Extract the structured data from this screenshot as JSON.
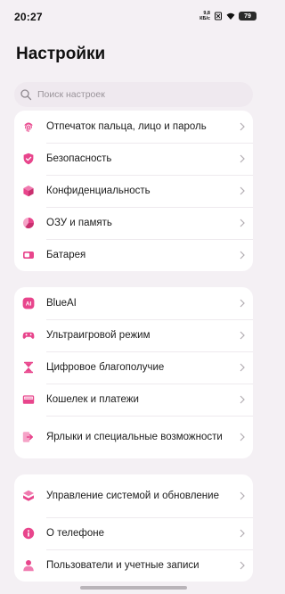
{
  "status": {
    "time": "20:27",
    "speed_value": "9,8",
    "speed_unit": "КБ/с",
    "battery": "79"
  },
  "page": {
    "title": "Настройки"
  },
  "search": {
    "placeholder": "Поиск настроек",
    "value": ""
  },
  "colors": {
    "accent": "#e8458c",
    "background": "#f4f0f4"
  },
  "groups": [
    {
      "items": [
        {
          "label": "Отпечаток пальца, лицо и пароль",
          "icon": "fingerprint-icon"
        },
        {
          "label": "Безопасность",
          "icon": "shield-icon"
        },
        {
          "label": "Конфиденциальность",
          "icon": "privacy-cube-icon"
        },
        {
          "label": "ОЗУ и память",
          "icon": "pie-chart-icon"
        },
        {
          "label": "Батарея",
          "icon": "battery-icon"
        }
      ]
    },
    {
      "items": [
        {
          "label": "BlueAI",
          "icon": "ai-icon"
        },
        {
          "label": "Ультраигровой режим",
          "icon": "gamepad-icon"
        },
        {
          "label": "Цифровое благополучие",
          "icon": "hourglass-icon"
        },
        {
          "label": "Кошелек и платежи",
          "icon": "wallet-icon"
        },
        {
          "label": "Ярлыки и специальные возможности",
          "icon": "shortcut-icon"
        }
      ]
    },
    {
      "items": [
        {
          "label": "Управление системой и обновление",
          "icon": "system-update-icon"
        },
        {
          "label": "О телефоне",
          "icon": "info-icon"
        },
        {
          "label": "Пользователи и учетные записи",
          "icon": "user-icon"
        }
      ]
    }
  ]
}
